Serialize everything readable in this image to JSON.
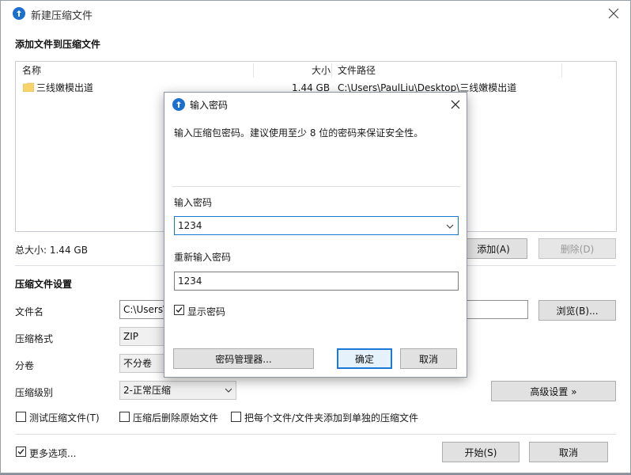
{
  "main": {
    "title": "新建压缩文件",
    "section_add": "添加文件到压缩文件",
    "columns": {
      "name": "名称",
      "size": "大小",
      "path": "文件路径"
    },
    "files": [
      {
        "name": "三线嫩模出道",
        "size": "1.44 GB",
        "path": "C:\\Users\\PaulLiu\\Desktop\\三线嫩模出道"
      }
    ],
    "total_size": "总大小: 1.44 GB",
    "add_button": "添加(A)",
    "delete_button": "删除(D)",
    "section_settings": "压缩文件设置",
    "filename_label": "文件名",
    "filename_value": "C:\\Users\\",
    "browse_button": "浏览(B)...",
    "format_label": "压缩格式",
    "format_value": "ZIP",
    "split_label": "分卷",
    "split_value": "不分卷",
    "level_label": "压缩级别",
    "level_value": "2-正常压缩",
    "advanced_button": "高级设置 »",
    "options": {
      "test": "测试压缩文件(T)",
      "delete_original": "压缩后删除原始文件",
      "separate": "把每个文件/文件夹添加到单独的压缩文件"
    },
    "more_options": "更多选项...",
    "start_button": "开始(S)",
    "cancel_button": "取消"
  },
  "dialog": {
    "title": "输入密码",
    "description": "输入压缩包密码。建议使用至少 8 位的密码来保证安全性。",
    "password_label": "输入密码",
    "password_value": "1234",
    "reenter_label": "重新输入密码",
    "reenter_value": "1234",
    "show_password": "显示密码",
    "manager_button": "密码管理器...",
    "ok_button": "确定",
    "cancel_button": "取消"
  },
  "colors": {
    "accent": "#1a78d6",
    "folder": "#f6d46a"
  }
}
